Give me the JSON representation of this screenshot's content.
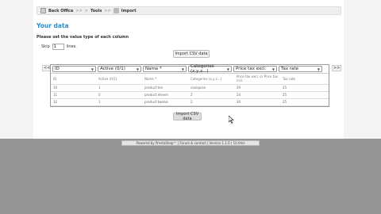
{
  "breadcrumb": {
    "items": [
      "Back Office",
      "Tools",
      "Import"
    ],
    "separator": ">"
  },
  "page_title": "Your data",
  "instructions": "Please set the value type of each column",
  "skip": {
    "label": "Skip",
    "value": "1",
    "suffix": "lines."
  },
  "import_button": "Import CSV data",
  "nav": {
    "prev": "<<",
    "next": ">>"
  },
  "column_selects": [
    "ID",
    "Active (0/1)",
    "Name *",
    "Categories (x,y,z...)",
    "Price tax excl.",
    "Tax rate"
  ],
  "table": {
    "header": [
      "ID",
      "Active (0/1)",
      "Name *",
      "Categories (x,y,z...)",
      "Price tax excl. or Price tax incl.",
      "Tax rate"
    ],
    "rows": [
      [
        "10",
        "1",
        "product ten",
        "caniquise",
        "29",
        "25"
      ],
      [
        "11",
        "0",
        "product eleven",
        "2",
        "24",
        "25"
      ],
      [
        "12",
        "1",
        "product twelve",
        "2",
        "30",
        "25"
      ]
    ]
  },
  "footer": "Powered by PrestaShop™ | Forum & contact | Version 1.1.0 | 10.0ms"
}
